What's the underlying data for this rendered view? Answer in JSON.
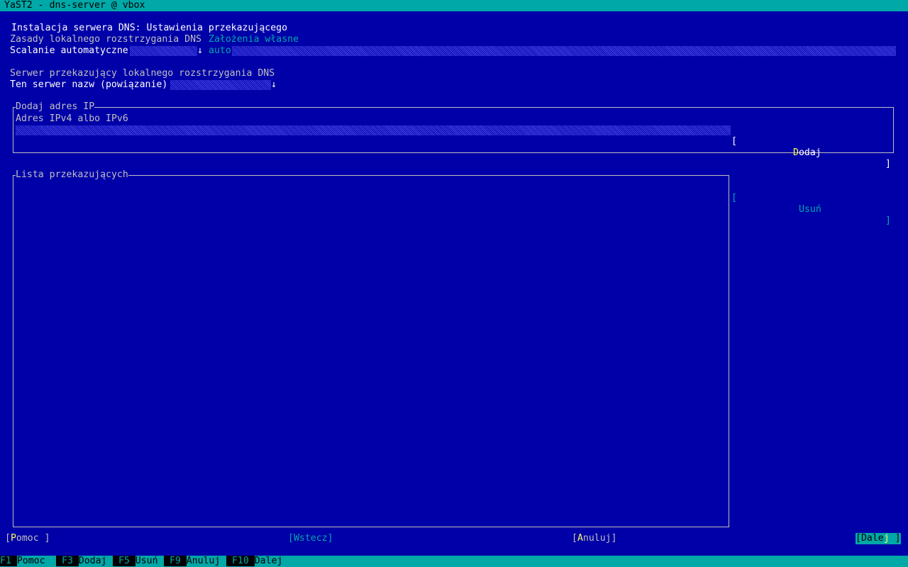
{
  "window": {
    "title": "YaST2 - dns-server @ vbox"
  },
  "dialog": {
    "heading": "Instalacja serwera DNS: Ustawienia przekazującego",
    "policy_label": "Zasady lokalnego rozstrzygania DNS",
    "policy_value": "Założenia własne",
    "merge_label": "Scalanie automatyczne",
    "merge_arrow": "↓",
    "merge_value": "auto",
    "forwarder_section": "Serwer przekazujący lokalnego rozstrzygania DNS",
    "nameserver_label": "Ten serwer nazw (powiązanie)",
    "nameserver_arrow": "↓"
  },
  "add_ip": {
    "frame_title": "Dodaj adres IP",
    "field_label": "Adres IPv4 albo IPv6",
    "field_value": "",
    "add_button": {
      "open": "[",
      "hot": "D",
      "rest": "odaj",
      "close": "]"
    }
  },
  "forwarders": {
    "frame_title": "Lista przekazujących",
    "items": [],
    "remove_button": {
      "open": "[",
      "label": "Usuń",
      "close": "]"
    }
  },
  "buttons": {
    "help": {
      "open": "[",
      "hot": "P",
      "rest": "omoc ",
      "close": "]"
    },
    "back": {
      "label": "[Wstecz]"
    },
    "cancel": {
      "open": "[",
      "hot": "A",
      "rest": "nuluj",
      "close": "]"
    },
    "next": {
      "open": "[",
      "pre": "Dale",
      "hot": "j",
      "post": " ",
      "close": "]"
    }
  },
  "function_keys": [
    {
      "key": "F1",
      "label": "Pomoc"
    },
    {
      "key": "F3",
      "label": "Dodaj"
    },
    {
      "key": "F5",
      "label": "Usuń"
    },
    {
      "key": "F9",
      "label": "Anuluj"
    },
    {
      "key": "F10",
      "label": "Dalej"
    }
  ],
  "colors": {
    "background": "#0000a8",
    "title_bar": "#00a8a8",
    "highlight": "#ffff54",
    "text": "#c0c0c0",
    "accent": "#00a8a8"
  }
}
